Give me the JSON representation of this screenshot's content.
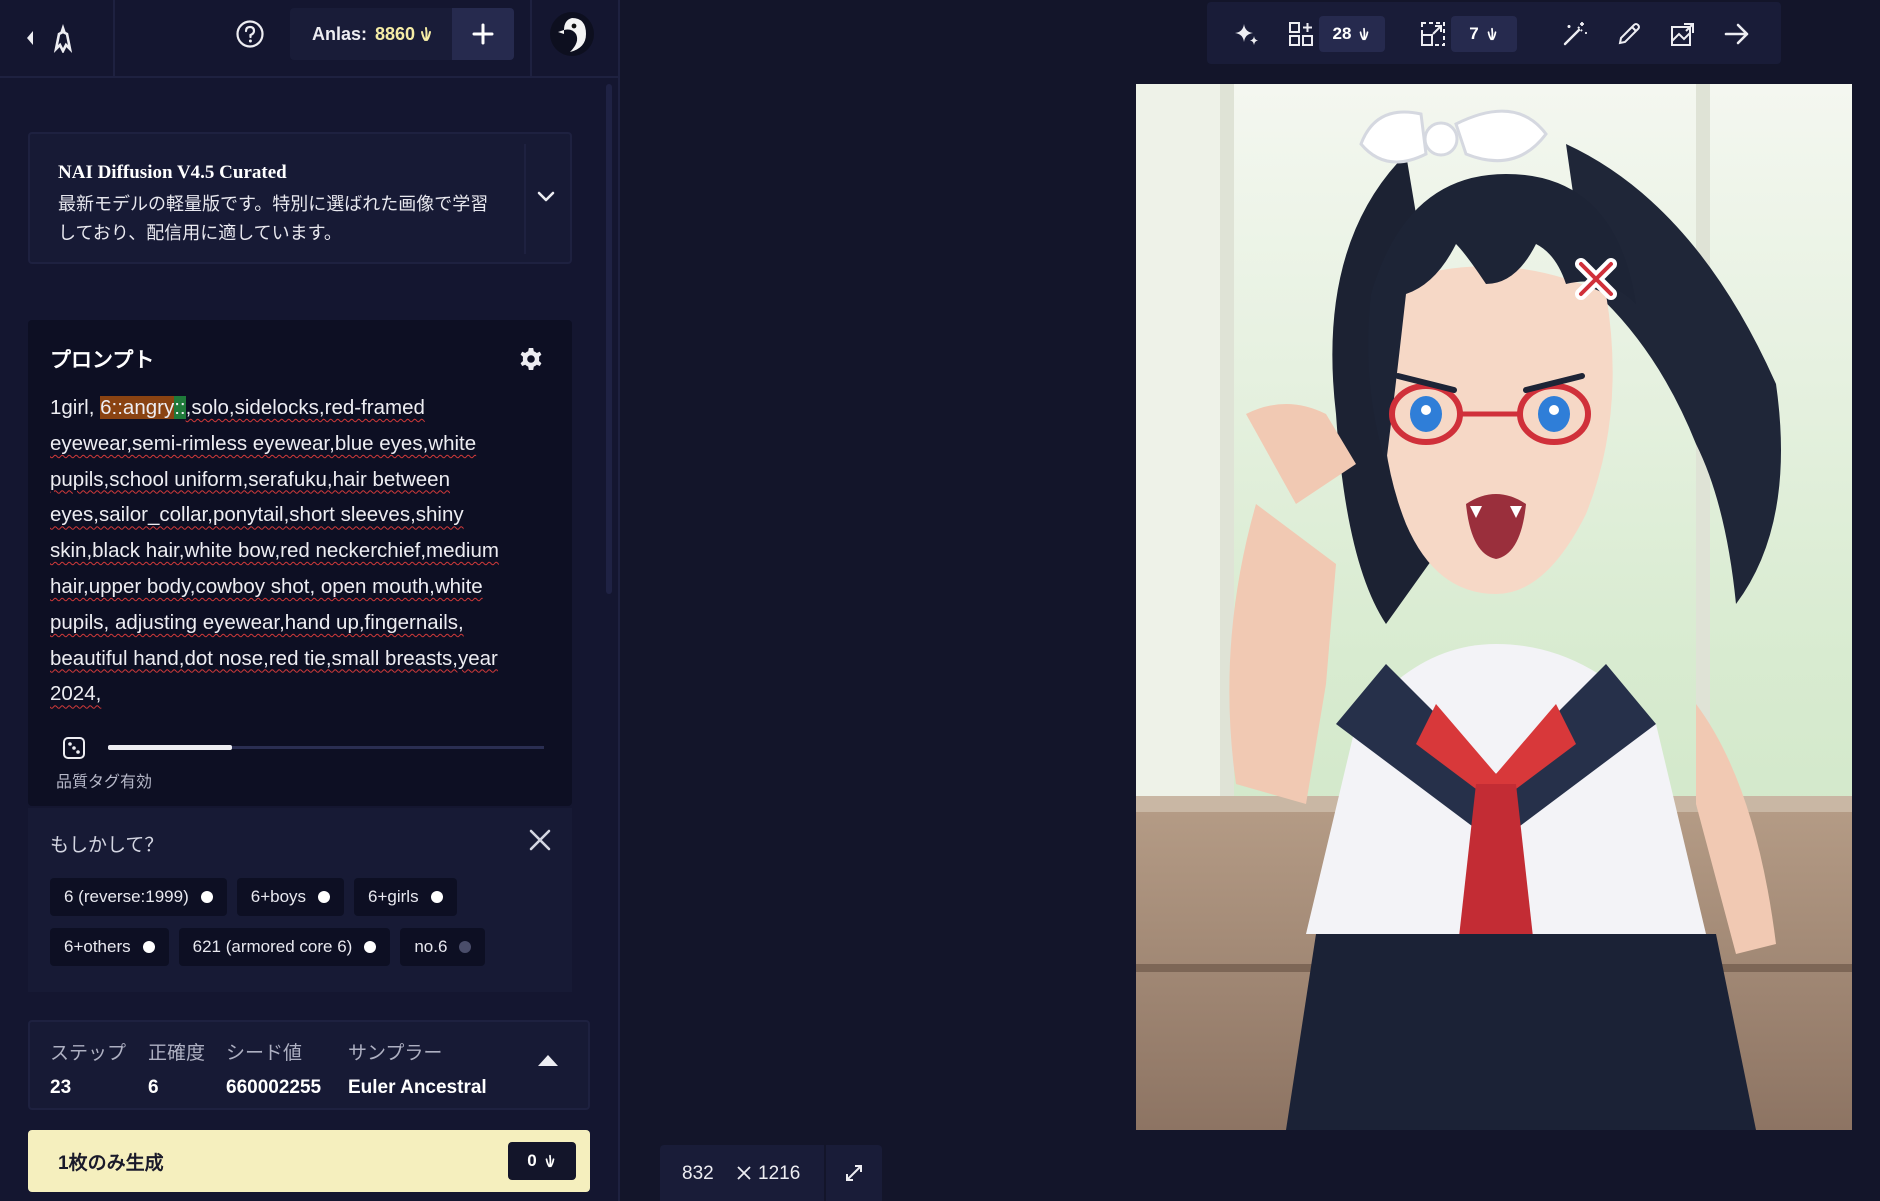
{
  "topbar": {
    "anlas_label": "Anlas:",
    "anlas_value": "8860"
  },
  "model": {
    "name": "NAI Diffusion V4.5 Curated",
    "description": "最新モデルの軽量版です。特別に選ばれた画像で学習しており、配信用に適しています。"
  },
  "prompt": {
    "title": "プロンプト",
    "quality_tag_label": "品質タグ有効",
    "text_segments": [
      "1girl, ",
      "6::angry",
      "::",
      ",solo,sidelocks,red-framed eyewear,semi-rimless eyewear,blue eyes,white pupils,school uniform,serafuku,hair between eyes,sailor_collar,ponytail,short sleeves,shiny skin,black hair,white bow,red neckerchief,medium hair,upper body,cowboy shot, open mouth,white pupils, adjusting eyewear,hand up,fingernails, beautiful hand,dot nose,red tie,small breasts,year 2024,"
    ]
  },
  "suggestions": {
    "title": "もしかして？",
    "chips": [
      {
        "label": "6 (reverse:1999)",
        "bright": true
      },
      {
        "label": "6+boys",
        "bright": true
      },
      {
        "label": "6+girls",
        "bright": true
      },
      {
        "label": "6+others",
        "bright": true
      },
      {
        "label": "621 (armored core 6)",
        "bright": true
      },
      {
        "label": "no.6",
        "bright": false
      }
    ]
  },
  "settings": {
    "steps_label": "ステップ",
    "steps_value": "23",
    "guidance_label": "正確度",
    "guidance_value": "6",
    "seed_label": "シード値",
    "seed_value": "660002255",
    "sampler_label": "サンプラー",
    "sampler_value": "Euler Ancestral"
  },
  "generate": {
    "label": "1枚のみ生成",
    "cost": "0"
  },
  "toolbar": {
    "variations_cost": "28",
    "upscale_cost": "7"
  },
  "image_size": {
    "width": "832",
    "height": "1216"
  },
  "colors": {
    "background": "#13152a",
    "panel": "#171a35",
    "anlas_accent": "#f5eca6",
    "generate_button": "#f5efbe",
    "highlight_weight": "#8a4312",
    "highlight_bracket": "#1f7a3a",
    "spellcheck_underline": "#d23a3a"
  }
}
